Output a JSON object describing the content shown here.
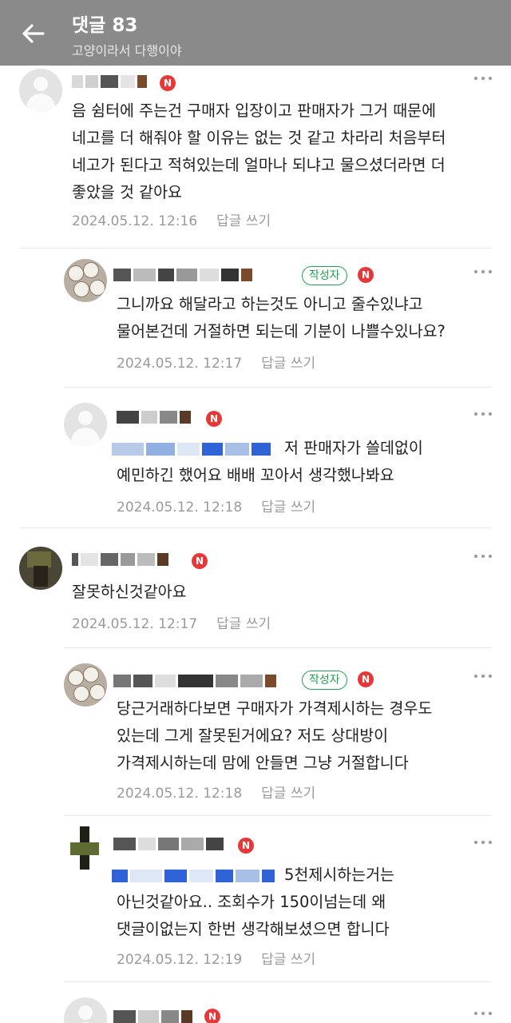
{
  "header": {
    "title": "댓글 83",
    "subtitle": "고양이라서 다행이야",
    "back_icon": "arrow-left-icon"
  },
  "badges": {
    "new": "N",
    "author": "작성자"
  },
  "colors": {
    "header_bg": "#8a8a8a",
    "author_green": "#1fa34d",
    "new_red": "#e53939",
    "meta_gray": "#9a9a9a"
  },
  "comments": [
    {
      "text": "음 쉼터에 주는건 구매자 입장이고 판매자가 그거 때문에\n네고를 더 해줘야 할 이유는 없는 것 같고 차라리 처음부터\n네고가 된다고 적혀있는데 얼마나 되냐고 물으셨더라면 더\n좋았을 것 같아요",
      "date": "2024.05.12. 12:16",
      "reply_label": "답글 쓰기"
    },
    {
      "text": "그니까요 해달라고 하는것도 아니고 줄수있냐고\n물어본건데 거절하면 되는데 기분이 나쁠수있나요?",
      "date": "2024.05.12. 12:17",
      "reply_label": "답글 쓰기"
    },
    {
      "text": "저 판매자가 쓸데없이\n예민하긴 했어요 배배 꼬아서 생각했나봐요",
      "date": "2024.05.12. 12:18",
      "reply_label": "답글 쓰기"
    },
    {
      "text": "잘못하신것같아요",
      "date": "2024.05.12. 12:17",
      "reply_label": "답글 쓰기"
    },
    {
      "text": "당근거래하다보면 구매자가 가격제시하는 경우도\n있는데 그게 잘못된거에요? 저도 상대방이\n가격제시하는데 맘에 안들면 그냥 거절합니다",
      "date": "2024.05.12. 12:18",
      "reply_label": "답글 쓰기"
    },
    {
      "text": "5천제시하는거는\n아닌것같아요.. 조회수가 150이넘는데 왜\n댓글이없는지 한번 생각해보셨으면 합니다",
      "date": "2024.05.12. 12:19",
      "reply_label": "답글 쓰기"
    }
  ]
}
